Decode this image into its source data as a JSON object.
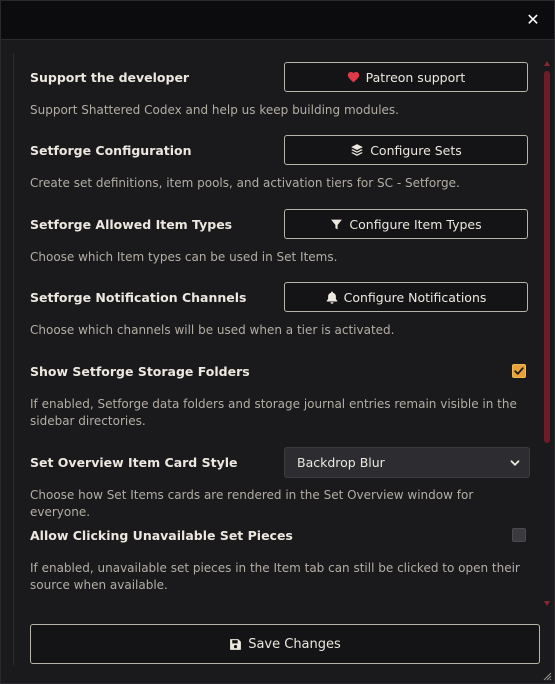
{
  "window": {
    "close_icon": "close-icon"
  },
  "settings": [
    {
      "label": "Support the developer",
      "control": "button",
      "button_label": "Patreon support",
      "icon": "heart-icon",
      "icon_color": "#e0394a",
      "hint": "Support Shattered Codex and help us keep building modules."
    },
    {
      "label": "Setforge Configuration",
      "control": "button",
      "button_label": "Configure Sets",
      "icon": "layers-icon",
      "hint": "Create set definitions, item pools, and activation tiers for SC - Setforge."
    },
    {
      "label": "Setforge Allowed Item Types",
      "control": "button",
      "button_label": "Configure Item Types",
      "icon": "filter-icon",
      "hint": "Choose which Item types can be used in Set Items."
    },
    {
      "label": "Setforge Notification Channels",
      "control": "button",
      "button_label": "Configure Notifications",
      "icon": "bell-icon",
      "hint": "Choose which channels will be used when a tier is activated."
    },
    {
      "label": "Show Setforge Storage Folders",
      "control": "checkbox",
      "checked": true,
      "hint": "If enabled, Setforge data folders and storage journal entries remain visible in the sidebar directories."
    },
    {
      "label": "Set Overview Item Card Style",
      "control": "select",
      "selected": "Backdrop Blur",
      "hint": "Choose how Set Items cards are rendered in the Set Overview window for everyone."
    },
    {
      "label": "Allow Clicking Unavailable Set Pieces",
      "control": "checkbox",
      "checked": false,
      "hint": "If enabled, unavailable set pieces in the Item tab can still be clicked to open their source when available."
    }
  ],
  "footer": {
    "save_label": "Save Changes",
    "icon": "save-icon"
  },
  "colors": {
    "accent": "#e8a23b",
    "scrollbar": "#6e1c28",
    "heart": "#e0394a"
  }
}
